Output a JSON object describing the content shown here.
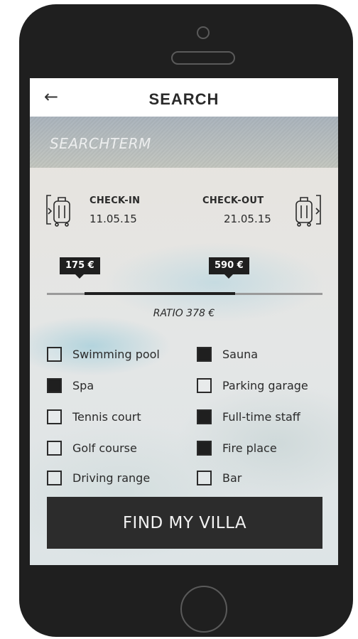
{
  "header": {
    "back_icon": "arrow-left-icon",
    "title": "SEARCH"
  },
  "search": {
    "term": "SEARCHTERM"
  },
  "checkin": {
    "label": "CHECK-IN",
    "date": "11.05.15",
    "icon": "luggage-icon"
  },
  "checkout": {
    "label": "CHECK-OUT",
    "date": "21.05.15",
    "icon": "luggage-icon"
  },
  "price": {
    "min_label": "175 €",
    "max_label": "590 €",
    "ratio": "RATIO 378 €"
  },
  "amenities": {
    "left": [
      {
        "label": "Swimming pool",
        "checked": false
      },
      {
        "label": "Spa",
        "checked": true
      },
      {
        "label": "Tennis court",
        "checked": false
      },
      {
        "label": "Golf course",
        "checked": false
      },
      {
        "label": "Driving range",
        "checked": false
      }
    ],
    "right": [
      {
        "label": "Sauna",
        "checked": true
      },
      {
        "label": "Parking garage",
        "checked": false
      },
      {
        "label": "Full-time staff",
        "checked": true
      },
      {
        "label": "Fire place",
        "checked": true
      },
      {
        "label": "Bar",
        "checked": false
      }
    ]
  },
  "cta": {
    "label": "FIND MY VILLA"
  },
  "colors": {
    "dark": "#1f1f1f",
    "button": "#2c2c2c",
    "text": "#2a2a2a"
  }
}
